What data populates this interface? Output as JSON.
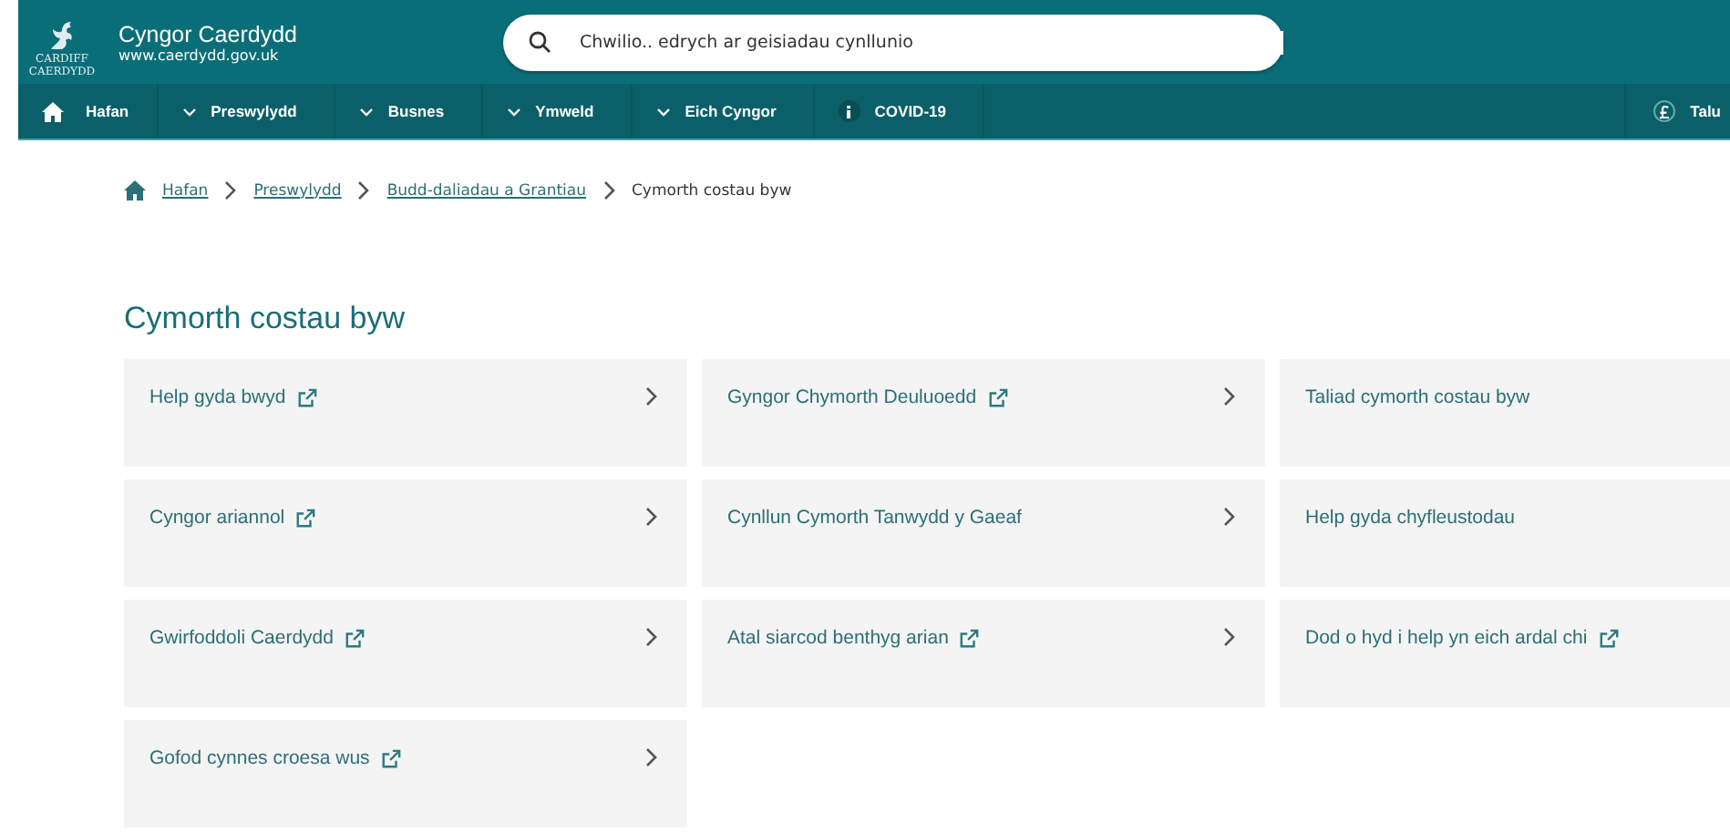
{
  "header": {
    "title": "Cyngor Caerdydd",
    "url": "www.caerdydd.gov.uk",
    "logo_text": [
      "CARDIFF",
      "CAERDYDD"
    ],
    "search": {
      "placeholder": "Chwilio.. edrych ar geisiadau cynllunio"
    }
  },
  "nav": [
    {
      "label": "Hafan",
      "kind": "home"
    },
    {
      "label": "Preswylydd",
      "kind": "dropdown"
    },
    {
      "label": "Busnes",
      "kind": "dropdown"
    },
    {
      "label": "Ymweld",
      "kind": "dropdown"
    },
    {
      "label": "Eich Cyngor",
      "kind": "dropdown"
    },
    {
      "label": "COVID-19",
      "kind": "info"
    }
  ],
  "nav_right": {
    "label": "Talu",
    "kind": "pound"
  },
  "breadcrumb": [
    {
      "label": "Hafan",
      "link": true
    },
    {
      "label": "Preswylydd",
      "link": true
    },
    {
      "label": "Budd-daliadau a Grantiau",
      "link": true
    },
    {
      "label": "Cymorth costau byw",
      "link": false
    }
  ],
  "heading": "Cymorth costau byw",
  "cards": [
    {
      "title": "Help gyda bwyd",
      "external": true
    },
    {
      "title": "Gyngor Chymorth Deuluoedd",
      "external": true
    },
    {
      "title": "Taliad cymorth costau byw",
      "external": false
    },
    {
      "title": "Cyngor ariannol",
      "external": true
    },
    {
      "title": "Cynllun Cymorth Tanwydd y Gaeaf",
      "external": false
    },
    {
      "title": "Help gyda chyfleustodau",
      "external": false
    },
    {
      "title": "Gwirfoddoli Caerdydd",
      "external": true
    },
    {
      "title": "Atal siarcod benthyg arian",
      "external": true
    },
    {
      "title": "Dod o hyd i help yn eich ardal chi",
      "external": true
    },
    {
      "title": "Gofod cynnes croesa wus",
      "external": true
    }
  ]
}
